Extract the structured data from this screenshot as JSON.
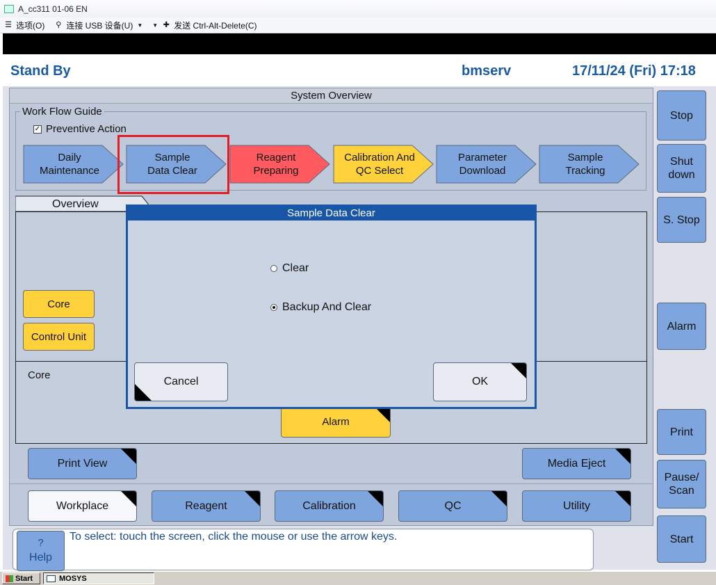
{
  "window": {
    "title": "A_cc311 01-06 EN",
    "menu": [
      {
        "label": "选项(O)"
      },
      {
        "label": "连接 USB 设备(U)"
      },
      {
        "label": "发送 Ctrl-Alt-Delete(C)"
      }
    ]
  },
  "header": {
    "status": "Stand By",
    "user": "bmserv",
    "datetime": "17/11/24 (Fri) 17:18"
  },
  "system_overview": {
    "title": "System Overview",
    "workflow_guide": {
      "label": "Work Flow Guide",
      "preventive_action": {
        "label": "Preventive Action",
        "checked": true,
        "check_mark": "✓"
      },
      "steps": [
        {
          "line1": "Daily",
          "line2": "Maintenance",
          "color": "#7ea5dd"
        },
        {
          "line1": "Sample",
          "line2": "Data Clear",
          "color": "#7ea5dd"
        },
        {
          "line1": "Reagent",
          "line2": "Preparing",
          "color": "#ff5a5f"
        },
        {
          "line1": "Calibration And",
          "line2": "QC Select",
          "color": "#ffd23c"
        },
        {
          "line1": "Parameter",
          "line2": "Download",
          "color": "#7ea5dd"
        },
        {
          "line1": "Sample",
          "line2": "Tracking",
          "color": "#7ea5dd"
        }
      ],
      "highlight_color": "#e31c23"
    },
    "overview_tab": "Overview",
    "overview_buttons": {
      "core": "Core",
      "control_unit": "Control Unit"
    },
    "core_section": {
      "label": "Core",
      "alarm": "Alarm"
    },
    "print_view": "Print View",
    "media_eject": "Media Eject",
    "bottom_tabs": [
      {
        "label": "Workplace",
        "active": true
      },
      {
        "label": "Reagent",
        "active": false
      },
      {
        "label": "Calibration",
        "active": false
      },
      {
        "label": "QC",
        "active": false
      },
      {
        "label": "Utility",
        "active": false
      }
    ]
  },
  "side_buttons": {
    "stop": "Stop",
    "shutdown_l1": "Shut",
    "shutdown_l2": "down",
    "s_stop": "S. Stop",
    "alarm": "Alarm",
    "print": "Print",
    "pause_l1": "Pause/",
    "pause_l2": "Scan",
    "start": "Start"
  },
  "help": {
    "q": "?",
    "label": "Help",
    "message": "To select: touch the screen, click the mouse or use the arrow keys."
  },
  "modal": {
    "title": "Sample Data Clear",
    "options": [
      {
        "label": "Clear",
        "selected": false
      },
      {
        "label": "Backup And Clear",
        "selected": true
      }
    ],
    "cancel": "Cancel",
    "ok": "OK"
  },
  "taskbar": {
    "start": "Start",
    "task": "MOSYS"
  },
  "colors": {
    "accent_blue": "#1a56a8",
    "button_blue": "#7ea5dd",
    "button_yellow": "#ffd23c",
    "button_red": "#ff5a5f",
    "header_text": "#1a5a9e"
  }
}
